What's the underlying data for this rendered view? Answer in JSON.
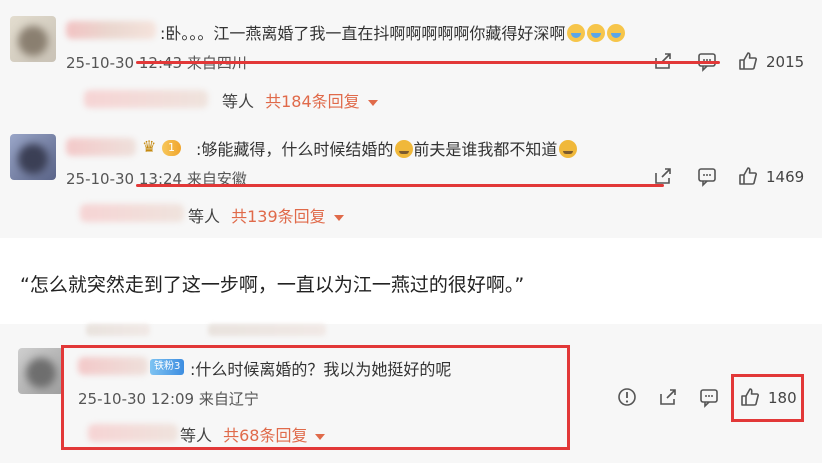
{
  "comments": [
    {
      "text": ":卧。。。江一燕离婚了我一直在抖啊啊啊啊啊你藏得好深啊",
      "meta": "25-10-30 12:43 来自四川",
      "likes": "2015",
      "replies_suffix": "等人",
      "replies_count": "共184条回复",
      "emoji_count": 3
    },
    {
      "text_a": ":够能藏得，什么时候结婚的",
      "text_b": "前夫是谁我都不知道",
      "meta": "25-10-30 13:24 来自安徽",
      "likes": "1469",
      "replies_suffix": "等人",
      "replies_count": "共139条回复",
      "level_badge": "1"
    },
    {
      "text": ":什么时候离婚的？我以为她挺好的呢",
      "meta": "25-10-30 12:09 来自辽宁",
      "likes": "180",
      "replies_suffix": "等人",
      "replies_count": "共68条回复",
      "fan_badge": "铁粉3"
    }
  ],
  "quote": "“怎么就突然走到了这一步啊，一直以为江一燕过的很好啊。”",
  "icons": {
    "share": "share-icon",
    "comment": "comment-icon",
    "like": "thumbs-up-icon",
    "report": "report-icon",
    "caret": "caret-down-icon"
  },
  "colors": {
    "annotation_red": "#e23838",
    "reply_accent": "#e06a4a",
    "panel_bg": "#f7f7f7"
  }
}
